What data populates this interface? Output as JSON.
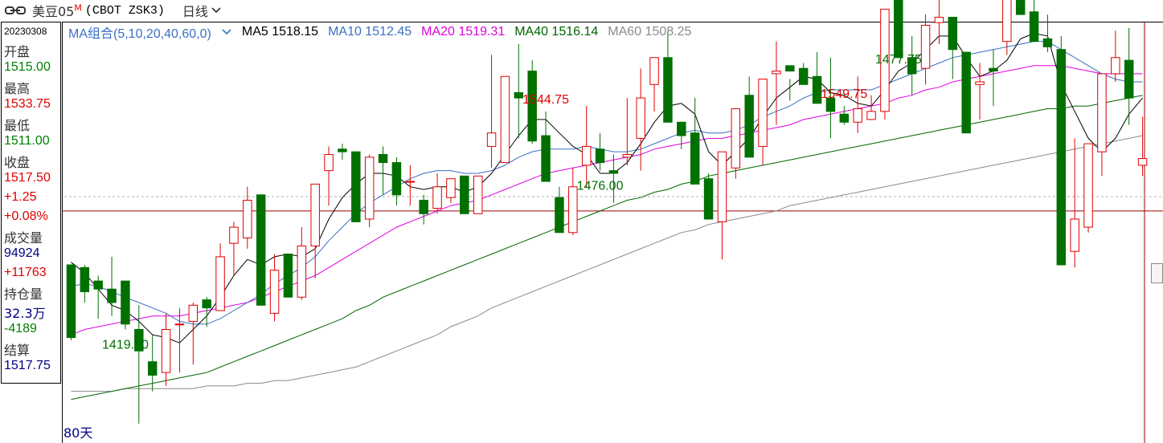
{
  "header": {
    "title": "美豆05",
    "title_sup": "M",
    "code": "(CBOT ZSK3)",
    "period": "日线"
  },
  "info": {
    "date": "20230308",
    "open_label": "开盘",
    "open": "1515.00",
    "high_label": "最高",
    "high": "1533.75",
    "low_label": "最低",
    "low": "1511.00",
    "close_label": "收盘",
    "close": "1517.50",
    "change": "+1.25",
    "change_pct": "+0.08%",
    "volume_label": "成交量",
    "volume": "94924",
    "volume_change": "+11763",
    "oi_label": "持仓量",
    "oi": "32.3万",
    "oi_change": "-4189",
    "settle_label": "结算",
    "settle": "1517.75"
  },
  "legend": {
    "combo": "MA组合(5,10,20,40,60,0)",
    "ma5": "MA5 1518.15",
    "ma10": "MA10 1512.45",
    "ma20": "MA20 1519.31",
    "ma40": "MA40 1516.14",
    "ma60": "MA60 1508.25"
  },
  "days_label": "80天",
  "colors": {
    "up": "#e00000",
    "down": "#007000",
    "ma5": "#000000",
    "ma10": "#3a6fc4",
    "ma20": "#e000e0",
    "ma40": "#006400",
    "ma60": "#8a8a8a"
  },
  "chart_data": {
    "type": "candlestick",
    "ylim": [
      1413,
      1560
    ],
    "crosshair_price": 1498,
    "annotations": [
      {
        "index": 35,
        "value": "1544.75"
      },
      {
        "index": 57,
        "value": "1549.75"
      },
      {
        "index": 39,
        "value": "1476.00"
      },
      {
        "index": 61,
        "value": "1477.75"
      },
      {
        "index": 4,
        "value": "1419.00"
      }
    ],
    "candles": [
      [
        1478,
        1478,
        1450,
        1451
      ],
      [
        1477,
        1478,
        1464,
        1468
      ],
      [
        1472,
        1474,
        1458,
        1469
      ],
      [
        1469,
        1481,
        1459,
        1464
      ],
      [
        1472,
        1472,
        1454,
        1456
      ],
      [
        1454,
        1463,
        1419,
        1446
      ],
      [
        1442,
        1452,
        1431,
        1437
      ],
      [
        1438,
        1460,
        1433,
        1454
      ],
      [
        1456,
        1462,
        1438,
        1456
      ],
      [
        1457,
        1464,
        1441,
        1463
      ],
      [
        1465,
        1466,
        1455,
        1462
      ],
      [
        1461,
        1486,
        1461,
        1481
      ],
      [
        1486,
        1494,
        1474,
        1492
      ],
      [
        1488,
        1507,
        1484,
        1502
      ],
      [
        1504,
        1504,
        1476,
        1463
      ],
      [
        1460,
        1482,
        1457,
        1476
      ],
      [
        1482,
        1481,
        1473,
        1466
      ],
      [
        1466,
        1492,
        1465,
        1485
      ],
      [
        1485,
        1506,
        1473,
        1508
      ],
      [
        1513,
        1522,
        1500,
        1519
      ],
      [
        1521,
        1523,
        1517,
        1520
      ],
      [
        1520,
        1520,
        1502,
        1494
      ],
      [
        1495,
        1519,
        1492,
        1518
      ],
      [
        1519,
        1522,
        1504,
        1516
      ],
      [
        1516,
        1518,
        1500,
        1504
      ],
      [
        1509,
        1515,
        1500,
        1509
      ],
      [
        1502,
        1504,
        1493,
        1497
      ],
      [
        1499,
        1512,
        1497,
        1507
      ],
      [
        1503,
        1509,
        1501,
        1510
      ],
      [
        1511,
        1511,
        1497,
        1497
      ],
      [
        1497,
        1510,
        1497,
        1511
      ],
      [
        1522,
        1556,
        1514,
        1527
      ],
      [
        1516,
        1536,
        1516,
        1548
      ],
      [
        1542,
        1560,
        1525,
        1540
      ],
      [
        1550,
        1554,
        1523,
        1524
      ],
      [
        1526,
        1535,
        1514,
        1509
      ],
      [
        1503,
        1507,
        1490,
        1490
      ],
      [
        1490,
        1514,
        1489,
        1507
      ],
      [
        1515,
        1537,
        1507,
        1522
      ],
      [
        1521,
        1527,
        1513,
        1516
      ],
      [
        1513,
        1519,
        1501,
        1512
      ],
      [
        1518,
        1540,
        1515,
        1519
      ],
      [
        1525,
        1551,
        1513,
        1540
      ],
      [
        1545,
        1555,
        1535,
        1555
      ],
      [
        1555,
        1565,
        1535,
        1531
      ],
      [
        1531,
        1531,
        1521,
        1526
      ],
      [
        1527,
        1540,
        1520,
        1508
      ],
      [
        1510,
        1512,
        1496,
        1495
      ],
      [
        1494,
        1498,
        1480,
        1520
      ],
      [
        1514,
        1523,
        1510,
        1536
      ],
      [
        1541,
        1548,
        1520,
        1518
      ],
      [
        1522,
        1547,
        1515,
        1547
      ],
      [
        1549,
        1561,
        1530,
        1550
      ],
      [
        1552,
        1547,
        1539,
        1550
      ],
      [
        1551,
        1553,
        1545,
        1545
      ],
      [
        1548,
        1557,
        1540,
        1538
      ],
      [
        1540,
        1555,
        1525,
        1535
      ],
      [
        1534,
        1537,
        1530,
        1531
      ],
      [
        1531,
        1548,
        1527,
        1536
      ],
      [
        1532,
        1541,
        1532,
        1535
      ],
      [
        1535,
        1568,
        1532,
        1573
      ],
      [
        1578,
        1583,
        1560,
        1555
      ],
      [
        1555,
        1563,
        1541,
        1549
      ],
      [
        1551,
        1571,
        1545,
        1567
      ],
      [
        1568,
        1583,
        1560,
        1570
      ],
      [
        1570,
        1570,
        1547,
        1558
      ],
      [
        1557,
        1557,
        1530,
        1527
      ],
      [
        1545,
        1553,
        1532,
        1546
      ],
      [
        1551,
        1558,
        1537,
        1550
      ],
      [
        1561,
        1588,
        1556,
        1589
      ],
      [
        1585,
        1592,
        1573,
        1571
      ],
      [
        1572,
        1587,
        1562,
        1561
      ],
      [
        1562,
        1571,
        1557,
        1559
      ],
      [
        1558,
        1563,
        1527,
        1478
      ],
      [
        1483,
        1525,
        1477,
        1495
      ],
      [
        1492,
        1520,
        1490,
        1523
      ],
      [
        1520,
        1533,
        1511,
        1549
      ],
      [
        1549,
        1565,
        1546,
        1555
      ],
      [
        1554,
        1566,
        1530,
        1540
      ],
      [
        1515,
        1533,
        1511,
        1517.5
      ]
    ],
    "ma5": [
      1479,
      1475,
      1469,
      1463,
      1461,
      1457,
      1452,
      1451,
      1449,
      1454,
      1459,
      1466,
      1474,
      1480,
      1478,
      1481,
      1482,
      1481,
      1484,
      1495,
      1503,
      1508,
      1512,
      1512,
      1511,
      1507,
      1506,
      1507,
      1507,
      1505,
      1507,
      1512,
      1519,
      1526,
      1532,
      1532,
      1527,
      1522,
      1519,
      1512,
      1512,
      1516,
      1523,
      1531,
      1537,
      1538,
      1534,
      1520,
      1515,
      1520,
      1525,
      1533,
      1540,
      1544,
      1548,
      1547,
      1542,
      1541,
      1538,
      1537,
      1543,
      1550,
      1553,
      1558,
      1563,
      1563,
      1555,
      1548,
      1550,
      1554,
      1562,
      1564,
      1563,
      1545,
      1535,
      1525,
      1520,
      1525,
      1534,
      1540
    ],
    "ma10": [
      1470,
      1471,
      1470,
      1468,
      1466,
      1464,
      1462,
      1460,
      1457,
      1456,
      1456,
      1458,
      1461,
      1464,
      1467,
      1471,
      1474,
      1477,
      1481,
      1487,
      1492,
      1497,
      1501,
      1504,
      1507,
      1510,
      1512,
      1513,
      1513,
      1512,
      1512,
      1513,
      1515,
      1518,
      1520,
      1521,
      1521,
      1521,
      1522,
      1521,
      1520,
      1520,
      1521,
      1523,
      1525,
      1527,
      1528,
      1527,
      1527,
      1528,
      1530,
      1533,
      1535,
      1537,
      1540,
      1542,
      1543,
      1543,
      1543,
      1543,
      1545,
      1547,
      1549,
      1551,
      1553,
      1555,
      1556,
      1557,
      1558,
      1559,
      1560,
      1561,
      1561,
      1558,
      1555,
      1552,
      1549,
      1547,
      1546,
      1546
    ],
    "ma20": [
      1452,
      1454,
      1455,
      1456,
      1457,
      1458,
      1459,
      1459,
      1459,
      1460,
      1461,
      1462,
      1463,
      1464,
      1466,
      1468,
      1470,
      1472,
      1474,
      1477,
      1480,
      1483,
      1486,
      1489,
      1492,
      1494,
      1496,
      1498,
      1500,
      1501,
      1502,
      1504,
      1506,
      1508,
      1510,
      1512,
      1513,
      1514,
      1515,
      1516,
      1517,
      1518,
      1519,
      1521,
      1522,
      1523,
      1524,
      1525,
      1525,
      1526,
      1527,
      1528,
      1529,
      1530,
      1532,
      1533,
      1534,
      1535,
      1536,
      1537,
      1538,
      1540,
      1541,
      1543,
      1544,
      1546,
      1547,
      1548,
      1549,
      1550,
      1551,
      1552,
      1552,
      1552,
      1551,
      1550,
      1549,
      1549,
      1549,
      1549
    ],
    "ma40": [
      1428,
      1429,
      1430,
      1431,
      1432,
      1433,
      1434,
      1435,
      1436,
      1437,
      1438,
      1440,
      1442,
      1444,
      1446,
      1448,
      1450,
      1452,
      1454,
      1456,
      1458,
      1461,
      1463,
      1466,
      1468,
      1470,
      1472,
      1474,
      1476,
      1478,
      1480,
      1482,
      1484,
      1486,
      1488,
      1490,
      1492,
      1494,
      1496,
      1498,
      1500,
      1502,
      1503,
      1505,
      1506,
      1508,
      1509,
      1511,
      1512,
      1513,
      1514,
      1515,
      1516,
      1517,
      1518,
      1519,
      1520,
      1521,
      1522,
      1523,
      1524,
      1525,
      1526,
      1527,
      1528,
      1529,
      1530,
      1531,
      1532,
      1533,
      1534,
      1535,
      1536,
      1536,
      1537,
      1537,
      1538,
      1539,
      1540,
      1541
    ],
    "ma60": [
      1431,
      1431,
      1431,
      1431,
      1432,
      1432,
      1432,
      1432,
      1432,
      1432,
      1433,
      1433,
      1433,
      1434,
      1434,
      1435,
      1435,
      1436,
      1437,
      1438,
      1439,
      1440,
      1442,
      1444,
      1446,
      1448,
      1450,
      1452,
      1455,
      1457,
      1459,
      1462,
      1464,
      1466,
      1468,
      1470,
      1472,
      1474,
      1476,
      1478,
      1480,
      1482,
      1484,
      1486,
      1488,
      1490,
      1491,
      1493,
      1494,
      1495,
      1496,
      1497,
      1498,
      1500,
      1501,
      1502,
      1503,
      1504,
      1505,
      1506,
      1507,
      1508,
      1509,
      1510,
      1511,
      1512,
      1513,
      1514,
      1515,
      1516,
      1517,
      1518,
      1519,
      1520,
      1521,
      1522,
      1523,
      1524,
      1525,
      1526
    ]
  }
}
